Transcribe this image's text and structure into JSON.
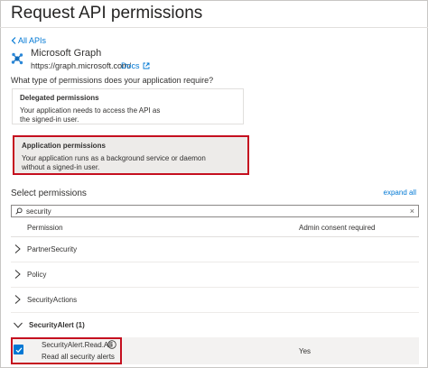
{
  "title": "Request API permissions",
  "back_link": "All APIs",
  "api": {
    "name": "Microsoft Graph",
    "url": "https://graph.microsoft.com/",
    "docs_label": "Docs",
    "logo_icon": "microsoft-graph-logo",
    "docs_icon": "external-link-icon"
  },
  "question": "What type of permissions does your application require?",
  "permission_types": {
    "delegated": {
      "title": "Delegated permissions",
      "description": "Your application needs to access the API as the signed-in user."
    },
    "application": {
      "title": "Application permissions",
      "description": "Your application runs as a background service or daemon without a signed-in user.",
      "selected": true
    }
  },
  "select_permissions": {
    "heading": "Select permissions",
    "expand_all": "expand all",
    "search_value": "security",
    "search_icon": "search-icon",
    "clear_icon": "close-icon",
    "clear_glyph": "×"
  },
  "columns": {
    "permission": "Permission",
    "admin_consent": "Admin consent required"
  },
  "groups": [
    {
      "label": "PartnerSecurity",
      "expanded": false
    },
    {
      "label": "Policy",
      "expanded": false
    },
    {
      "label": "SecurityActions",
      "expanded": false
    },
    {
      "label": "SecurityAlert (1)",
      "expanded": true
    }
  ],
  "selected_permission": {
    "name": "SecurityAlert.Read.All",
    "description": "Read all security alerts",
    "admin_consent": "Yes",
    "checked": true
  },
  "colors": {
    "accent": "#0078d4",
    "highlight_border": "#c50f1f",
    "selected_card_bg": "#edebe9"
  }
}
